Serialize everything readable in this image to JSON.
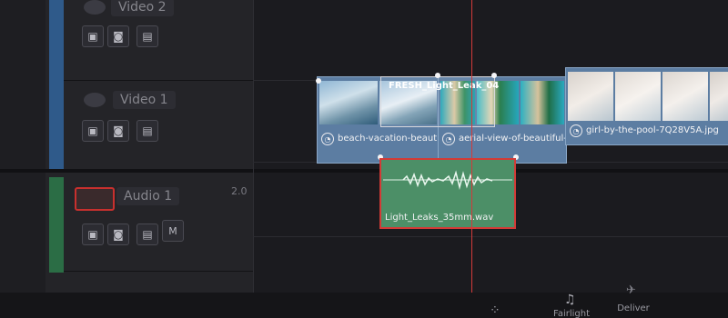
{
  "tracks": {
    "video2": {
      "name": "Video 2"
    },
    "video1": {
      "name": "Video 1"
    },
    "audio1": {
      "name": "Audio 1",
      "volume": "2.0",
      "mute_label": "M"
    }
  },
  "clips": {
    "video": [
      {
        "label": "beach-vacation-beautiful-..."
      },
      {
        "label": "aerial-view-of-beautiful-hotel-in-..."
      },
      {
        "label": "girl-by-the-pool-7Q28V5A.jpg"
      }
    ],
    "overlay": {
      "label": "FRESH_Light_Leak_04"
    },
    "audio": {
      "label": "Light_Leaks_35mm.wav"
    }
  },
  "bottom_bar": {
    "tabs": [
      {
        "label": "Fairlight"
      },
      {
        "label": "Deliver"
      }
    ]
  },
  "colors": {
    "video_clip": "#5c7da2",
    "audio_clip": "#4c8f67",
    "playhead": "#d33a3a",
    "selection": "#d33a36"
  }
}
